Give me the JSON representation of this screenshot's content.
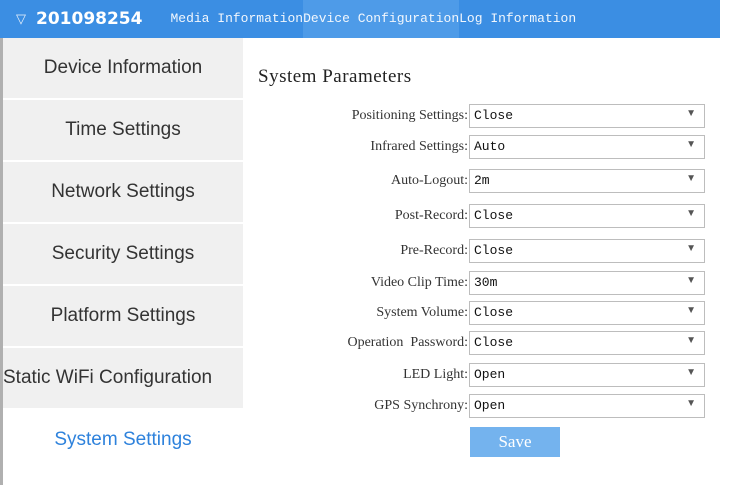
{
  "header": {
    "device_id": "201098254",
    "tabs": [
      {
        "label": "Media Information",
        "active": false
      },
      {
        "label": "Device Configuration",
        "active": true
      },
      {
        "label": "Log Information",
        "active": false
      }
    ]
  },
  "sidebar": {
    "items": [
      {
        "label": "Device Information"
      },
      {
        "label": "Time Settings"
      },
      {
        "label": "Network Settings"
      },
      {
        "label": "Security Settings"
      },
      {
        "label": "Platform Settings"
      },
      {
        "label": "Static WiFi Configuration"
      },
      {
        "label": "System Settings",
        "active": true
      }
    ]
  },
  "main": {
    "title": "System Parameters",
    "fields": [
      {
        "label": "Positioning Settings:",
        "value": "Close"
      },
      {
        "label": "Infrared Settings:",
        "value": "Auto"
      },
      {
        "label": "Auto-Logout:",
        "value": "2m"
      },
      {
        "label": "Post-Record:",
        "value": "Close"
      },
      {
        "label": "Pre-Record:",
        "value": "Close"
      },
      {
        "label": "Video Clip Time:",
        "value": "30m"
      },
      {
        "label": "System Volume:",
        "value": "Close"
      },
      {
        "label": "Operation  Password:",
        "value": "Close"
      },
      {
        "label": "LED Light:",
        "value": "Open"
      },
      {
        "label": "GPS Synchrony:",
        "value": "Open"
      }
    ],
    "save_label": "Save"
  },
  "colors": {
    "header_bg": "#3b8ee3",
    "accent_text": "#2e82dc",
    "button_bg": "#74b3ee"
  },
  "icons": {
    "device_toggle": "triangle-down-icon",
    "select_arrow": "chevron-down-icon"
  }
}
